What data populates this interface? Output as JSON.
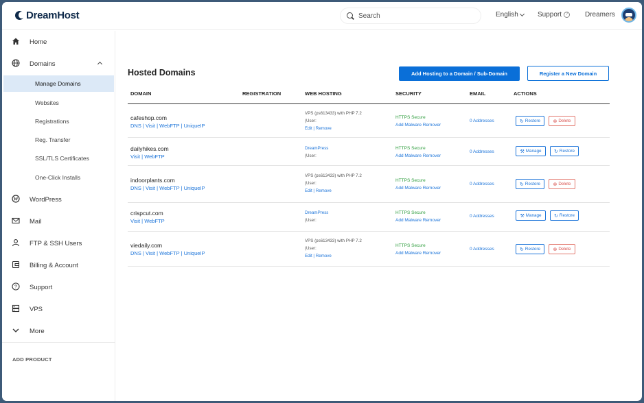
{
  "header": {
    "logo_text": "DreamHost",
    "search_placeholder": "Search",
    "language": "English",
    "support": "Support",
    "user": "Dreamers"
  },
  "sidebar": {
    "items": [
      {
        "label": "Home",
        "icon": "home-icon"
      },
      {
        "label": "Domains",
        "icon": "globe-icon"
      },
      {
        "label": "WordPress",
        "icon": "wordpress-icon"
      },
      {
        "label": "Mail",
        "icon": "mail-icon"
      },
      {
        "label": "FTP & SSH Users",
        "icon": "user-icon"
      },
      {
        "label": "Billing & Account",
        "icon": "billing-icon"
      },
      {
        "label": "Support",
        "icon": "help-icon"
      },
      {
        "label": "VPS",
        "icon": "server-icon"
      },
      {
        "label": "More",
        "icon": "chevron-down-icon"
      }
    ],
    "sub_items": [
      {
        "label": "Manage Domains",
        "active": true
      },
      {
        "label": "Websites"
      },
      {
        "label": "Registrations"
      },
      {
        "label": "Reg. Transfer"
      },
      {
        "label": "SSL/TLS Certificates"
      },
      {
        "label": "One-Click Installs"
      }
    ],
    "add_product": "ADD PRODUCT"
  },
  "main": {
    "title": "Hosted Domains",
    "add_hosting_button": "Add Hosting to a Domain / Sub-Domain",
    "register_button": "Register a New Domain",
    "columns": [
      "DOMAIN",
      "REGISTRATION",
      "WEB HOSTING",
      "SECURITY",
      "EMAIL",
      "ACTIONS"
    ],
    "rows": [
      {
        "domain": "cafeshop.com",
        "links": [
          "DNS",
          "Visit",
          "WebFTP",
          "UniqueIP"
        ],
        "hosting": [
          "VPS (ps613433) with PHP 7.2",
          "(User:"
        ],
        "hosting_links": [
          "Edit",
          "Remove"
        ],
        "security": [
          "HTTPS Secure",
          "Add Malware Remover"
        ],
        "email": "0 Addresses",
        "actions": [
          "Restore",
          "Delete"
        ]
      },
      {
        "domain": "dailyhikes.com",
        "links": [
          "Visit",
          "WebFTP"
        ],
        "hosting": [
          "DreamPress",
          "(User:"
        ],
        "hosting_links": [],
        "security": [
          "HTTPS Secure",
          "Add Malware Remover"
        ],
        "email": "0 Addresses",
        "actions": [
          "Manage",
          "Restore"
        ]
      },
      {
        "domain": "indoorplants.com",
        "links": [
          "DNS",
          "Visit",
          "WebFTP",
          "UniqueIP"
        ],
        "hosting": [
          "VPS (ps613433) with PHP 7.2",
          "(User:"
        ],
        "hosting_links": [
          "Edit",
          "Remove"
        ],
        "security": [
          "HTTPS Secure",
          "Add Malware Remover"
        ],
        "email": "0 Addresses",
        "actions": [
          "Restore",
          "Delete"
        ]
      },
      {
        "domain": "crispcut.com",
        "links": [
          "Visit",
          "WebFTP"
        ],
        "hosting": [
          "DreamPress",
          "(User:"
        ],
        "hosting_links": [],
        "security": [
          "HTTPS Secure",
          "Add Malware Remover"
        ],
        "email": "0 Addresses",
        "actions": [
          "Manage",
          "Restore"
        ]
      },
      {
        "domain": "viedaily.com",
        "links": [
          "DNS",
          "Visit",
          "WebFTP",
          "UniqueIP"
        ],
        "hosting": [
          "VPS (ps613433) with PHP 7.2",
          "(User:"
        ],
        "hosting_links": [
          "Edit",
          "Remove"
        ],
        "security": [
          "HTTPS Secure",
          "Add Malware Remover"
        ],
        "email": "0 Addresses",
        "actions": [
          "Restore",
          "Delete"
        ]
      }
    ]
  },
  "colors": {
    "primary": "#0a6fd8",
    "link": "#1a73d9",
    "secure": "#2e9d3d",
    "danger": "#d9534f",
    "active_bg": "#dce9f7",
    "brand": "#0f2a4a"
  }
}
